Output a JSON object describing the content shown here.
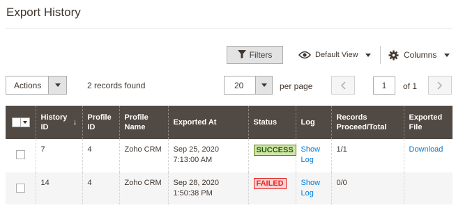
{
  "page": {
    "title": "Export History"
  },
  "toolbar": {
    "filters_label": "Filters",
    "view_label": "Default View",
    "columns_label": "Columns",
    "actions_label": "Actions",
    "records_found": "2 records found",
    "per_page_value": "20",
    "per_page_label": "per page",
    "current_page": "1",
    "page_of": "of 1"
  },
  "table": {
    "headers": {
      "history_id": "History ID",
      "profile_id": "Profile ID",
      "profile_name": "Profile Name",
      "exported_at": "Exported At",
      "status": "Status",
      "log": "Log",
      "records": "Records Proceed/Total",
      "exported_file": "Exported File"
    },
    "rows": [
      {
        "history_id": "7",
        "profile_id": "4",
        "profile_name": "Zoho CRM",
        "exported_at_date": "Sep 25, 2020",
        "exported_at_time": "7:13:00 AM",
        "status": "SUCCESS",
        "log_line1": "Show",
        "log_line2": "Log",
        "records": "1/1",
        "exported_file": "Download"
      },
      {
        "history_id": "14",
        "profile_id": "4",
        "profile_name": "Zoho CRM",
        "exported_at_date": "Sep 28, 2020",
        "exported_at_time": "1:50:38 PM",
        "status": "FAILED",
        "log_line1": "Show",
        "log_line2": "Log",
        "records": "0/0",
        "exported_file": ""
      }
    ]
  },
  "colors": {
    "header_bg": "#514943",
    "link": "#007bdb",
    "success_bg": "#d0e5a9",
    "failed_bg": "#f9d4d4"
  },
  "icons": [
    "filter-icon",
    "eye-icon",
    "gear-icon",
    "chevron-left-icon",
    "chevron-right-icon",
    "sort-down-arrow-icon"
  ]
}
